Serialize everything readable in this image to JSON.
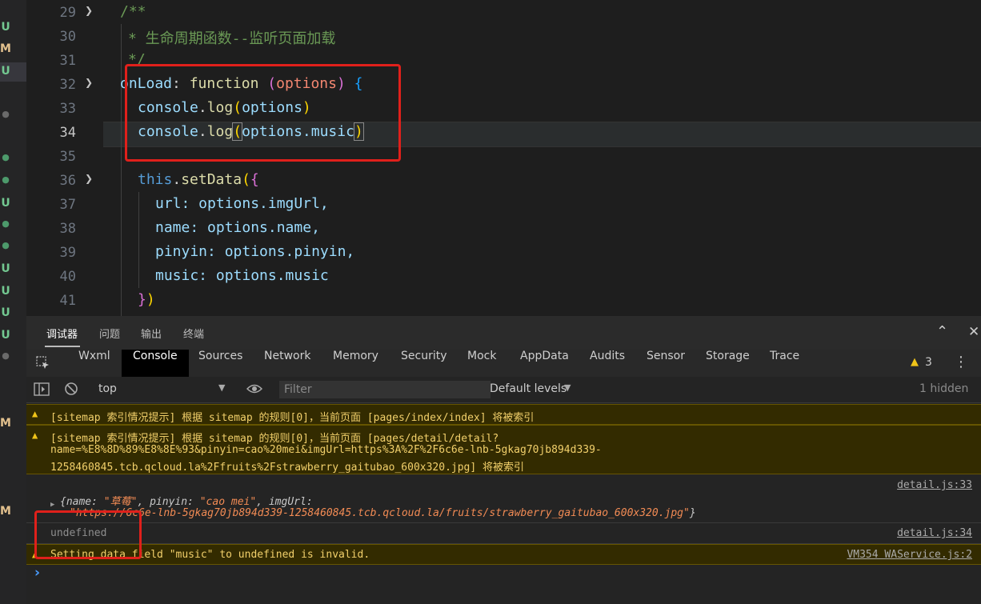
{
  "gutter_markers": [
    {
      "label": "U",
      "kind": "U"
    },
    {
      "label": "M",
      "kind": "M"
    },
    {
      "label": "U",
      "kind": "U"
    },
    {
      "label": "U",
      "kind": "U"
    },
    {
      "label": "U",
      "kind": "U"
    },
    {
      "label": "U",
      "kind": "U"
    },
    {
      "label": "U",
      "kind": "U"
    },
    {
      "label": "U",
      "kind": "U"
    },
    {
      "label": "M",
      "kind": "M"
    },
    {
      "label": "M",
      "kind": "M"
    }
  ],
  "editor": {
    "line_numbers": [
      "29",
      "30",
      "31",
      "32",
      "33",
      "34",
      "35",
      "36",
      "37",
      "38",
      "39",
      "40",
      "41"
    ],
    "lines": {
      "l29": "/**",
      "l30": "* 生命周期函数--监听页面加载",
      "l31": "*/",
      "l32_name": "onLoad",
      "l32_colon": ":",
      "l32_kw": "function",
      "l32_open": "(",
      "l32_param": "options",
      "l32_close": ")",
      "l32_brace": "{",
      "l33_obj": "console",
      "l33_dot": ".",
      "l33_fn": "log",
      "l33_open": "(",
      "l33_arg": "options",
      "l33_close": ")",
      "l34_obj": "console",
      "l34_dot": ".",
      "l34_fn": "log",
      "l34_open": "(",
      "l34_arg": "options.music",
      "l34_close": ")",
      "l36_this": "this",
      "l36_dot": ".",
      "l36_fn": "setData",
      "l36_open": "(",
      "l36_brace": "{",
      "l37": "url: options.imgUrl,",
      "l38": "name: options.name,",
      "l39": "pinyin: options.pinyin,",
      "l40": "music: options.music",
      "l41_brace": "}",
      "l41_paren": ")"
    }
  },
  "panel": {
    "tabs": [
      "调试器",
      "问题",
      "输出",
      "终端"
    ],
    "devtools_tabs": [
      "Wxml",
      "Console",
      "Sources",
      "Network",
      "Memory",
      "Security",
      "Mock",
      "AppData",
      "Audits",
      "Sensor",
      "Storage",
      "Trace"
    ],
    "warning_count": "3",
    "context": "top",
    "filter_placeholder": "Filter",
    "levels": "Default levels",
    "hidden": "1 hidden"
  },
  "console": {
    "warn1": "[sitemap 索引情况提示] 根据 sitemap 的规则[0]，当前页面 [pages/index/index] 将被索引",
    "warn2_l1": "[sitemap 索引情况提示] 根据 sitemap 的规则[0]，当前页面 [pages/detail/detail?",
    "warn2_l2": "name=%E8%8D%89%E8%8E%93&pinyin=cao%20mei&imgUrl=https%3A%2F%2F6c6e-lnb-5gkag70jb894d339-",
    "warn2_l3": "1258460845.tcb.qcloud.la%2Ffruits%2Fstrawberry_gaitubao_600x320.jpg] 将被索引",
    "log1_source": "detail.js:33",
    "log1_key_name": "name",
    "log1_val_name": "\"草莓\"",
    "log1_key_pinyin": "pinyin",
    "log1_val_pinyin": "\"cao mei\"",
    "log1_key_img": "imgUrl",
    "log1_val_img": "\"https://6c6e-lnb-5gkag70jb894d339-1258460845.tcb.qcloud.la/fruits/strawberry_gaitubao_600x320.jpg\"",
    "log2": "undefined",
    "log2_source": "detail.js:34",
    "warn3": "Setting data field \"music\" to undefined is invalid.",
    "warn3_source": "VM354 WAService.js:2",
    "prompt": "›"
  },
  "colors": {
    "annotation": "#e0201b",
    "warning_bg": "#332b00",
    "warning_text": "#f2d06b"
  }
}
